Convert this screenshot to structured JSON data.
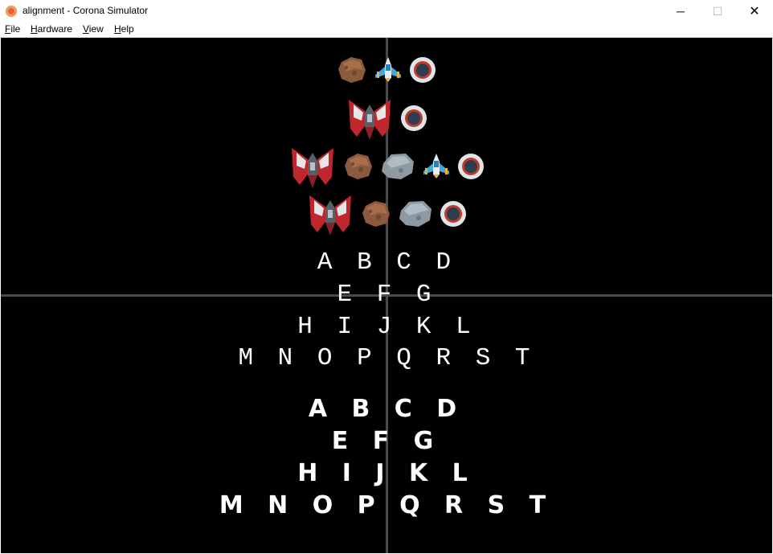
{
  "window": {
    "title": "alignment - Corona Simulator",
    "minimize_glyph": "─",
    "maximize_glyph": "☐",
    "close_glyph": "✕"
  },
  "menu": {
    "items": [
      "File",
      "Hardware",
      "View",
      "Help"
    ]
  },
  "canvas": {
    "background": "#000000",
    "guide_color": "#4a4a4a",
    "sprite_rows": [
      [
        "asteroid-brown",
        "ship-blue",
        "target-ring"
      ],
      [
        "ship-red",
        "target-ring"
      ],
      [
        "ship-red",
        "asteroid-brown",
        "asteroid-gray",
        "ship-blue",
        "target-ring"
      ],
      [
        "ship-red",
        "asteroid-brown",
        "asteroid-gray",
        "target-ring"
      ]
    ],
    "serif_lines": [
      "ABCD",
      "EFG",
      "HIJKL",
      "MNOPQRST"
    ],
    "sans_lines": [
      "ABCD",
      "EFG",
      "HIJKL",
      "MNOPQRST"
    ]
  }
}
